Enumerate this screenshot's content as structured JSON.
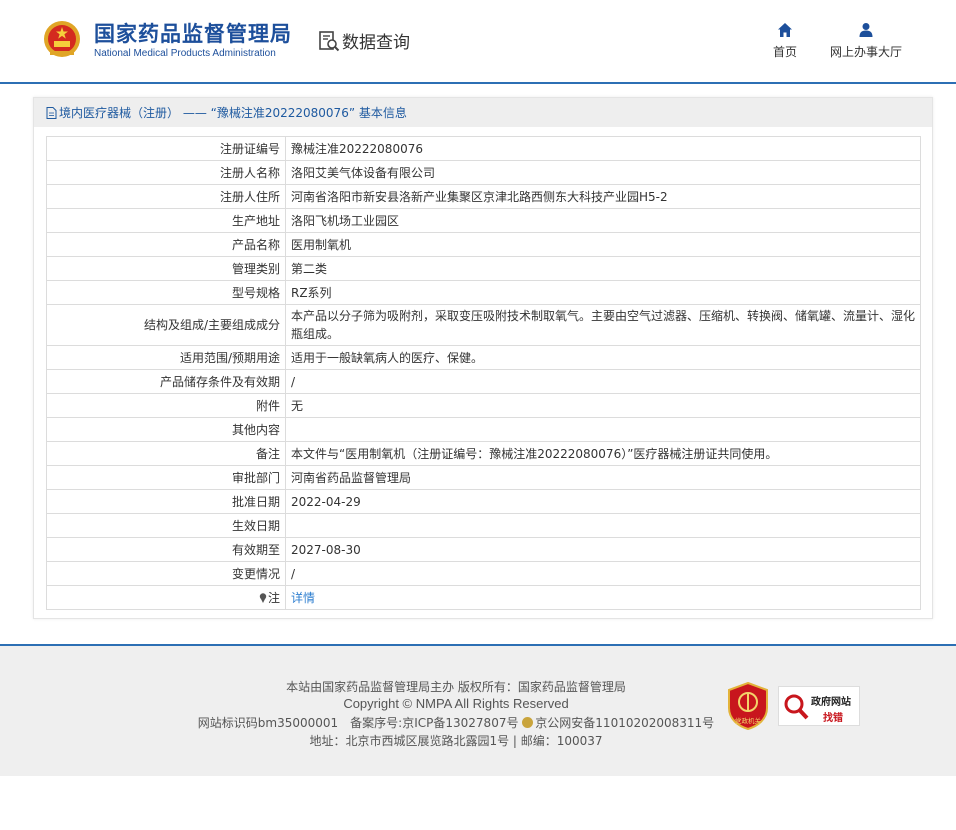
{
  "header": {
    "title_cn": "国家药品监督管理局",
    "title_en": "National Medical Products Administration",
    "query_label": "数据查询",
    "nav": {
      "home": "首页",
      "hall": "网上办事大厅"
    }
  },
  "panel": {
    "breadcrumb": "境内医疗器械（注册） —— “豫械注准20222080076” 基本信息",
    "rows": [
      {
        "label": "注册证编号",
        "value": "豫械注准20222080076"
      },
      {
        "label": "注册人名称",
        "value": "洛阳艾美气体设备有限公司"
      },
      {
        "label": "注册人住所",
        "value": "河南省洛阳市新安县洛新产业集聚区京津北路西侧东大科技产业园H5-2"
      },
      {
        "label": "生产地址",
        "value": "洛阳飞机场工业园区"
      },
      {
        "label": "产品名称",
        "value": "医用制氧机"
      },
      {
        "label": "管理类别",
        "value": "第二类"
      },
      {
        "label": "型号规格",
        "value": "RZ系列"
      },
      {
        "label": "结构及组成/主要组成成分",
        "value": "本产品以分子筛为吸附剂，采取变压吸附技术制取氧气。主要由空气过滤器、压缩机、转换阀、储氧罐、流量计、湿化瓶组成。"
      },
      {
        "label": "适用范围/预期用途",
        "value": "适用于一般缺氧病人的医疗、保健。"
      },
      {
        "label": "产品储存条件及有效期",
        "value": "/"
      },
      {
        "label": "附件",
        "value": "无"
      },
      {
        "label": "其他内容",
        "value": ""
      },
      {
        "label": "备注",
        "value": "本文件与“医用制氧机（注册证编号：豫械注准20222080076）”医疗器械注册证共同使用。"
      },
      {
        "label": "审批部门",
        "value": "河南省药品监督管理局"
      },
      {
        "label": "批准日期",
        "value": "2022-04-29"
      },
      {
        "label": "生效日期",
        "value": ""
      },
      {
        "label": "有效期至",
        "value": "2027-08-30"
      },
      {
        "label": "变更情况",
        "value": "/"
      }
    ],
    "note_label": "注",
    "note_link": "详情"
  },
  "footer": {
    "line1": "本站由国家药品监督管理局主办 版权所有：国家药品监督管理局",
    "line2": "Copyright © NMPA All Rights Reserved",
    "icp_prefix": "网站标识码bm35000001　备案序号:京ICP备13027807号",
    "police": "京公网安备11010202008311号",
    "address": "地址：北京市西城区展览路北露园1号 | 邮编：100037",
    "seal_text": "党政机关",
    "gov_error_t1": "政府网站",
    "gov_error_t2": "找错"
  },
  "colors": {
    "brand_blue": "#1d4f9b",
    "link": "#2f7fd0",
    "accent_red": "#c8161d"
  }
}
